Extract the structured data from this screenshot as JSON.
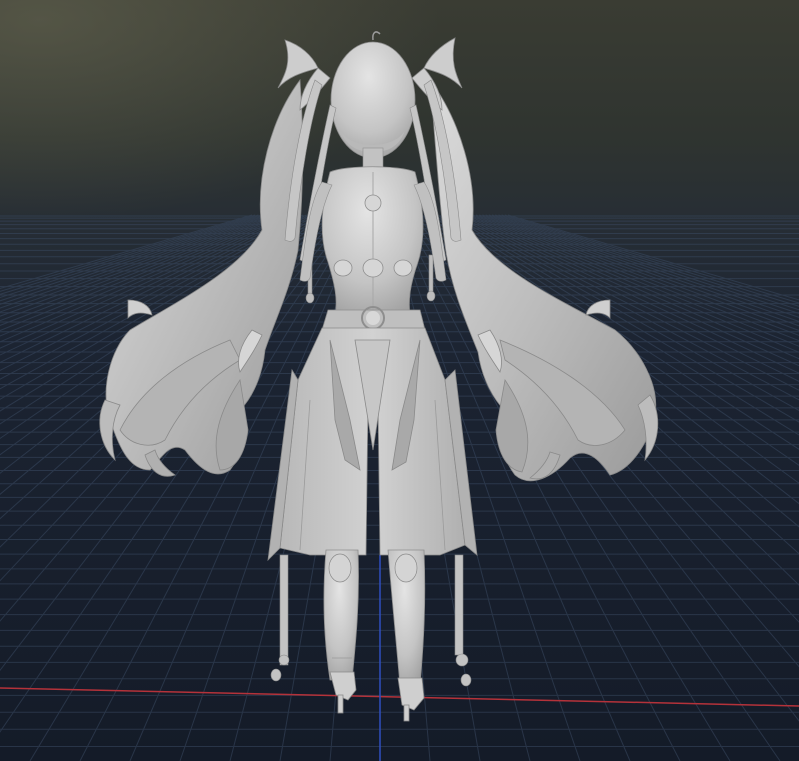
{
  "viewport": {
    "kind": "3d-model-viewport",
    "background_top_color": "#3d3f36",
    "background_horizon_color": "#242b34",
    "background_floor_color": "#17202e",
    "grid_line_color": "#3a4a62",
    "x_axis_color": "#b5323a",
    "z_axis_color": "#2f4fc0"
  },
  "model": {
    "shading": "untextured clay",
    "clay_color": "#c9c9c9",
    "clay_shadow_color": "#8e8e8e",
    "clay_highlight_color": "#e6e6e6",
    "view": "back"
  }
}
